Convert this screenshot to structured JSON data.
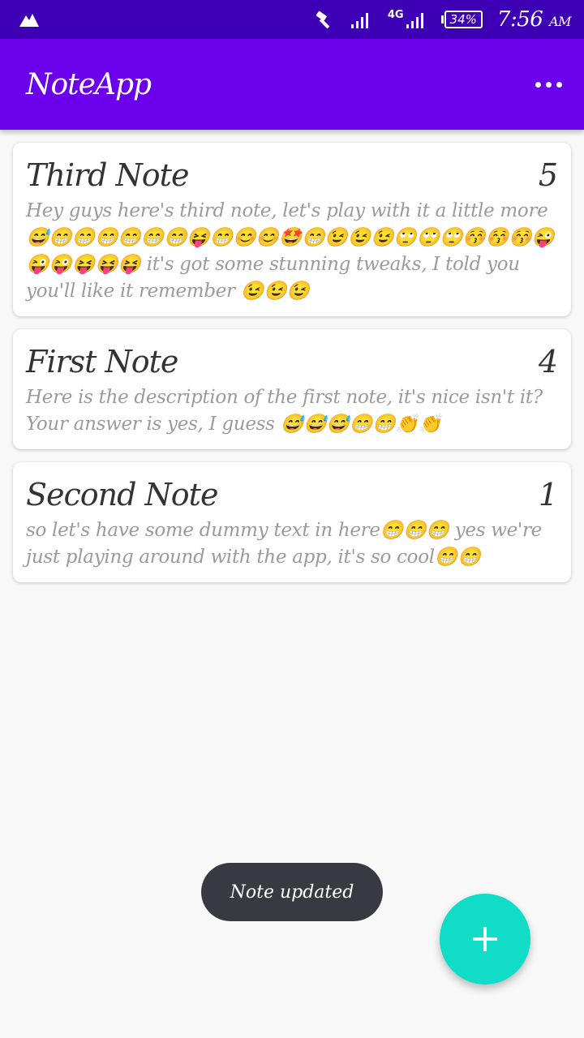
{
  "status_bar": {
    "network_type": "4G",
    "battery_percent": "34%",
    "time": "7:56",
    "time_suffix": "AM"
  },
  "app_bar": {
    "title": "NoteApp",
    "overflow_icon": "more-horiz-icon"
  },
  "notes": [
    {
      "title": "Third Note",
      "priority": "5",
      "description": "Hey guys here's third note, let's play with it a little more 😅😁😁😁😁😁😁😝😁😊😊🤩😁😉😉😉🙄🙄🙄😚😚😚😜😜😜😝😝😝 it's got some stunning tweaks, I told you you'll like it remember 😉😉😉"
    },
    {
      "title": "First Note",
      "priority": "4",
      "description": "Here is the description of the first note, it's nice isn't it? Your answer is yes, I guess 😅😅😅😁😁👏👏"
    },
    {
      "title": "Second Note",
      "priority": "1",
      "description": "so let's have some dummy text in here😁😁😁 yes we're just playing around with the app, it's so cool😁😁"
    }
  ],
  "toast": {
    "message": "Note updated"
  },
  "fab": {
    "icon": "add-icon"
  },
  "colors": {
    "status_bar": "#3d00b5",
    "app_bar": "#6b00ea",
    "fab": "#10dcc7",
    "toast": "#373a40"
  }
}
